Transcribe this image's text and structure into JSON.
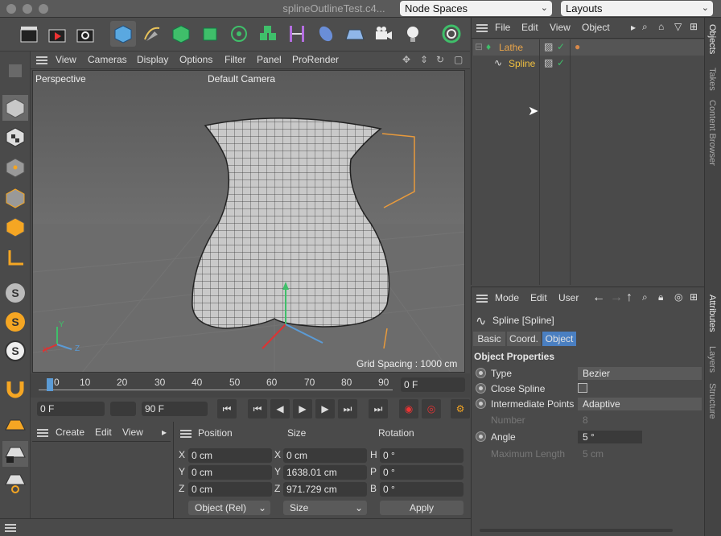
{
  "window": {
    "file_title": "splineOutlineTest.c4...",
    "node_spaces": "Node Spaces",
    "layouts": "Layouts"
  },
  "viewport": {
    "menu": [
      "View",
      "Cameras",
      "Display",
      "Options",
      "Filter",
      "Panel",
      "ProRender"
    ],
    "projection": "Perspective",
    "camera": "Default Camera",
    "grid_spacing": "Grid Spacing : 1000 cm",
    "axis_x": "X",
    "axis_y": "Y",
    "axis_z": "Z"
  },
  "timeline": {
    "ticks": [
      "0",
      "10",
      "20",
      "30",
      "40",
      "50",
      "60",
      "70",
      "80",
      "90"
    ],
    "current_frame": "0 F"
  },
  "transport": {
    "start_field": "0 F",
    "end_field": "90 F"
  },
  "materials": {
    "menu": [
      "Create",
      "Edit",
      "View"
    ]
  },
  "coords": {
    "headers": [
      "Position",
      "Size",
      "Rotation"
    ],
    "position": [
      {
        "axis": "X",
        "value": "0 cm"
      },
      {
        "axis": "Y",
        "value": "0 cm"
      },
      {
        "axis": "Z",
        "value": "0 cm"
      }
    ],
    "size": [
      {
        "axis": "X",
        "value": "0 cm"
      },
      {
        "axis": "Y",
        "value": "1638.01 cm"
      },
      {
        "axis": "Z",
        "value": "971.729 cm"
      }
    ],
    "rotation": [
      {
        "axis": "H",
        "value": "0 °"
      },
      {
        "axis": "P",
        "value": "0 °"
      },
      {
        "axis": "B",
        "value": "0 °"
      }
    ],
    "mode_select": "Object (Rel)",
    "size_select": "Size",
    "apply": "Apply"
  },
  "object_manager": {
    "menu": [
      "File",
      "Edit",
      "View",
      "Object"
    ],
    "objects": [
      {
        "name": "Lathe",
        "color": "#e8a44a"
      },
      {
        "name": "Spline",
        "color": "#f0c040"
      }
    ]
  },
  "attributes": {
    "menu": [
      "Mode",
      "Edit",
      "User"
    ],
    "title": "Spline [Spline]",
    "tabs": [
      "Basic",
      "Coord.",
      "Object"
    ],
    "active_tab": "Object",
    "section": "Object Properties",
    "rows": [
      {
        "label": "Type",
        "value": "Bezier",
        "enabled": true
      },
      {
        "label": "Close Spline",
        "value": "",
        "enabled": true
      },
      {
        "label": "Intermediate Points",
        "value": "Adaptive",
        "enabled": true
      },
      {
        "label": "Number",
        "value": "8",
        "enabled": false
      },
      {
        "label": "Angle",
        "value": "5 °",
        "enabled": true
      },
      {
        "label": "Maximum Length",
        "value": "5 cm",
        "enabled": false
      }
    ]
  },
  "right_tabs": [
    "Objects",
    "Takes",
    "Content Browser",
    "Attributes",
    "Layers",
    "Structure"
  ],
  "colors": {
    "accent_blue": "#5b9bd5",
    "selected_tab": "#4a7fc1"
  }
}
